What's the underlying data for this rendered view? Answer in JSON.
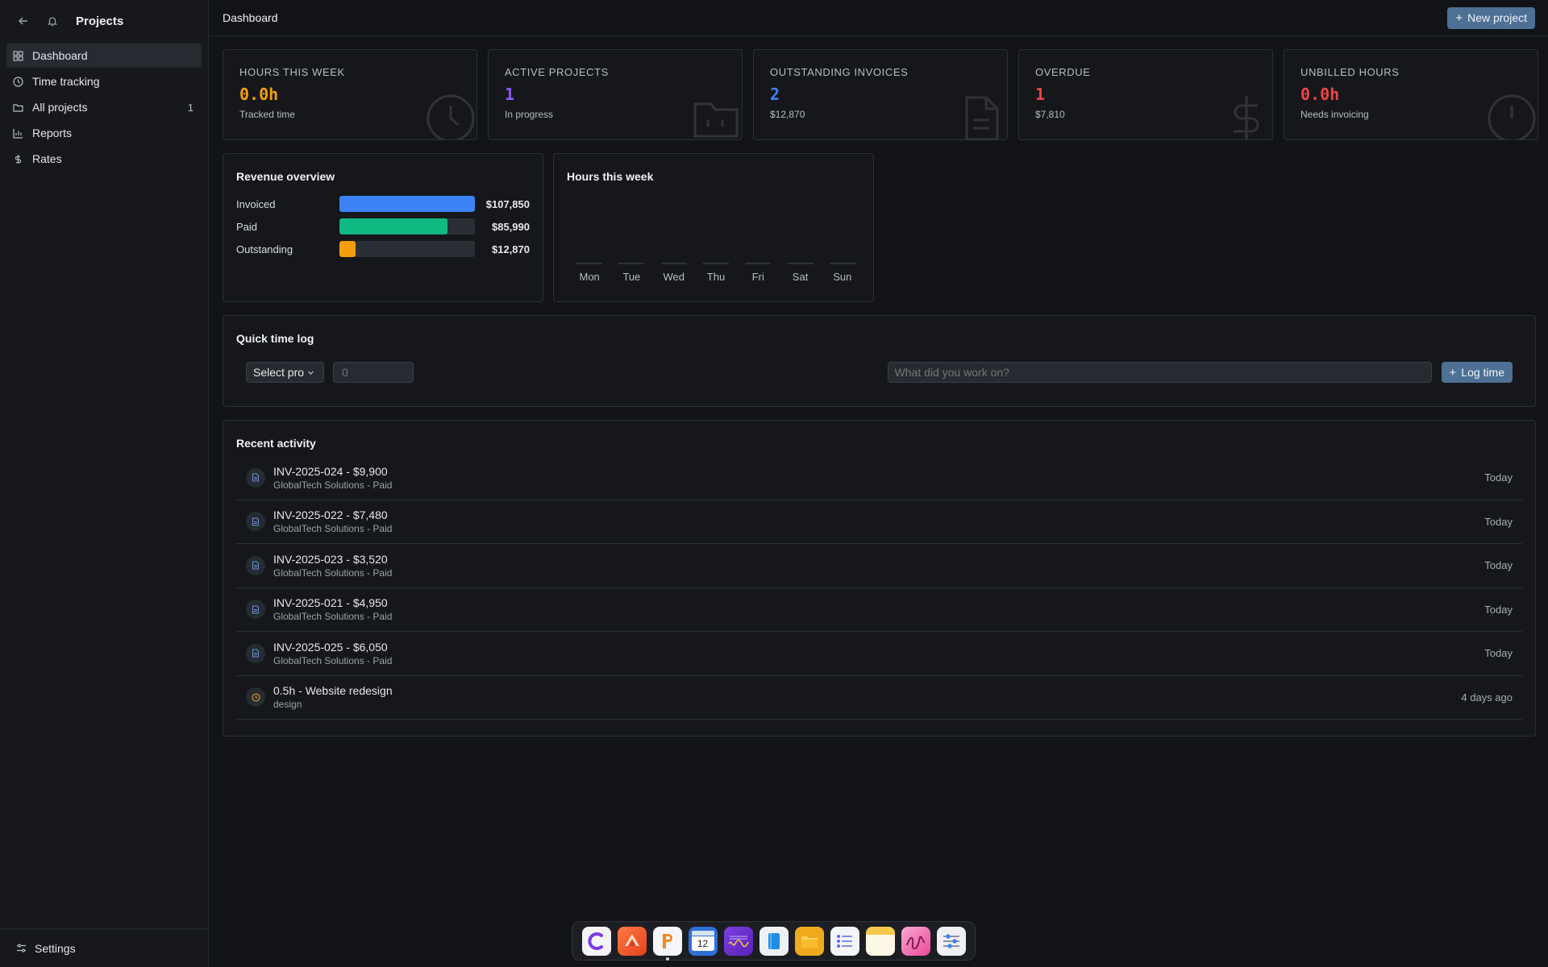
{
  "sidebar": {
    "title": "Projects",
    "items": [
      {
        "label": "Dashboard",
        "icon": "dashboard-icon",
        "active": true,
        "count": ""
      },
      {
        "label": "Time tracking",
        "icon": "clock-icon",
        "active": false,
        "count": ""
      },
      {
        "label": "All projects",
        "icon": "folder-icon",
        "active": false,
        "count": "1"
      },
      {
        "label": "Reports",
        "icon": "bar-chart-icon",
        "active": false,
        "count": ""
      },
      {
        "label": "Rates",
        "icon": "dollar-icon",
        "active": false,
        "count": ""
      }
    ],
    "settings_label": "Settings"
  },
  "header": {
    "title": "Dashboard",
    "new_project_label": "New project"
  },
  "stats": [
    {
      "label": "HOURS THIS WEEK",
      "value": "0.0h",
      "sub": "Tracked time",
      "color": "#f59e0b",
      "icon": "clock-icon"
    },
    {
      "label": "ACTIVE PROJECTS",
      "value": "1",
      "sub": "In progress",
      "color": "#8b5cf6",
      "icon": "folder-icon"
    },
    {
      "label": "OUTSTANDING INVOICES",
      "value": "2",
      "sub": "$12,870",
      "color": "#3b82f6",
      "icon": "file-icon"
    },
    {
      "label": "OVERDUE",
      "value": "1",
      "sub": "$7,810",
      "color": "#ef4444",
      "icon": "dollar-icon"
    },
    {
      "label": "UNBILLED HOURS",
      "value": "0.0h",
      "sub": "Needs invoicing",
      "color": "#ef4444",
      "icon": "clock-icon"
    }
  ],
  "revenue": {
    "title": "Revenue overview",
    "rows": [
      {
        "label": "Invoiced",
        "value": "$107,850",
        "fraction": 1.0,
        "color": "#3b82f6"
      },
      {
        "label": "Paid",
        "value": "$85,990",
        "fraction": 0.797,
        "color": "#10b981"
      },
      {
        "label": "Outstanding",
        "value": "$12,870",
        "fraction": 0.119,
        "color": "#f59e0b"
      }
    ]
  },
  "hours_chart": {
    "title": "Hours this week",
    "days": [
      "Mon",
      "Tue",
      "Wed",
      "Thu",
      "Fri",
      "Sat",
      "Sun"
    ],
    "values": [
      0,
      0,
      0,
      0,
      0,
      0,
      0
    ]
  },
  "quick_log": {
    "title": "Quick time log",
    "select_value": "Select pro",
    "hours_placeholder": "0",
    "description_placeholder": "What did you work on?",
    "log_button_label": "Log time"
  },
  "activity": {
    "title": "Recent activity",
    "items": [
      {
        "title": "INV-2025-024 - $9,900",
        "sub": "GlobalTech Solutions - Paid",
        "time": "Today",
        "icon": "document-icon"
      },
      {
        "title": "INV-2025-022 - $7,480",
        "sub": "GlobalTech Solutions - Paid",
        "time": "Today",
        "icon": "document-icon"
      },
      {
        "title": "INV-2025-023 - $3,520",
        "sub": "GlobalTech Solutions - Paid",
        "time": "Today",
        "icon": "document-icon"
      },
      {
        "title": "INV-2025-021 - $4,950",
        "sub": "GlobalTech Solutions - Paid",
        "time": "Today",
        "icon": "document-icon"
      },
      {
        "title": "INV-2025-025 - $6,050",
        "sub": "GlobalTech Solutions - Paid",
        "time": "Today",
        "icon": "document-icon"
      },
      {
        "title": "0.5h - Website redesign",
        "sub": "design",
        "time": "4 days ago",
        "icon": "clock-icon"
      }
    ]
  },
  "dock": {
    "apps": [
      {
        "icon": "c-app-icon"
      },
      {
        "icon": "affinity-app-icon"
      },
      {
        "icon": "pages-app-icon",
        "running": true
      },
      {
        "icon": "calendar-app-icon",
        "calendar_day": "12"
      },
      {
        "icon": "waveform-app-icon"
      },
      {
        "icon": "book-app-icon"
      },
      {
        "icon": "files-app-icon"
      },
      {
        "icon": "list-app-icon"
      },
      {
        "icon": "notes-app-icon"
      },
      {
        "icon": "scribble-app-icon"
      },
      {
        "icon": "settings-app-icon"
      }
    ]
  }
}
